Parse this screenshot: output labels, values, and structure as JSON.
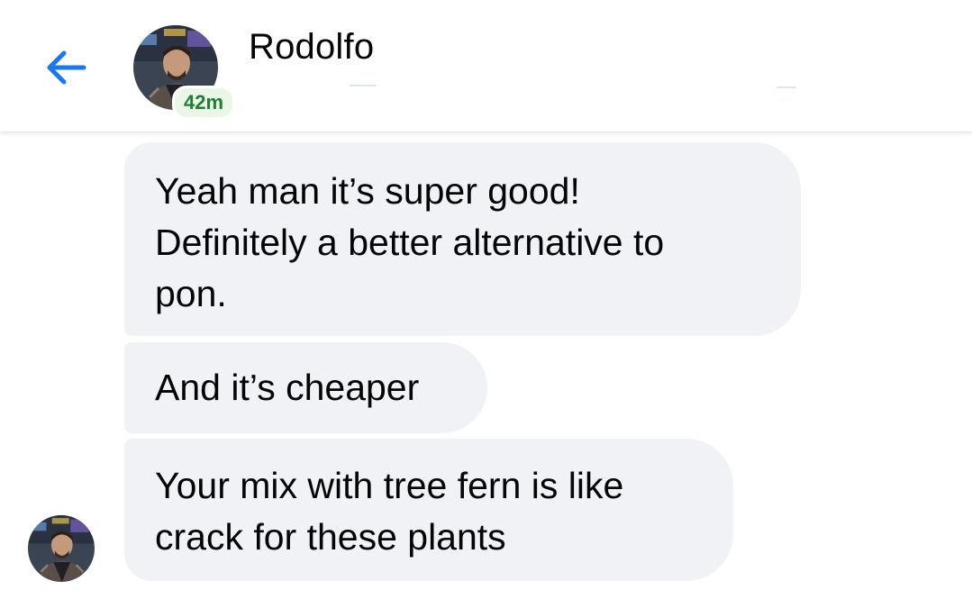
{
  "header": {
    "contact_name": "Rodolfo",
    "active_status": "42m"
  },
  "messages": [
    {
      "lines": [
        "Yeah man it’s super good!",
        "Definitely a better alternative to",
        "pon."
      ]
    },
    {
      "lines": [
        "And it’s cheaper"
      ]
    },
    {
      "lines": [
        "Your mix with tree fern is like",
        "crack for these plants"
      ]
    }
  ],
  "colors": {
    "accent": "#1877f2",
    "bubble_bg": "#f1f2f6",
    "active_green": "#1e7e34"
  },
  "icons": {
    "back": "arrow-left-icon",
    "avatar": "profile-photo"
  }
}
